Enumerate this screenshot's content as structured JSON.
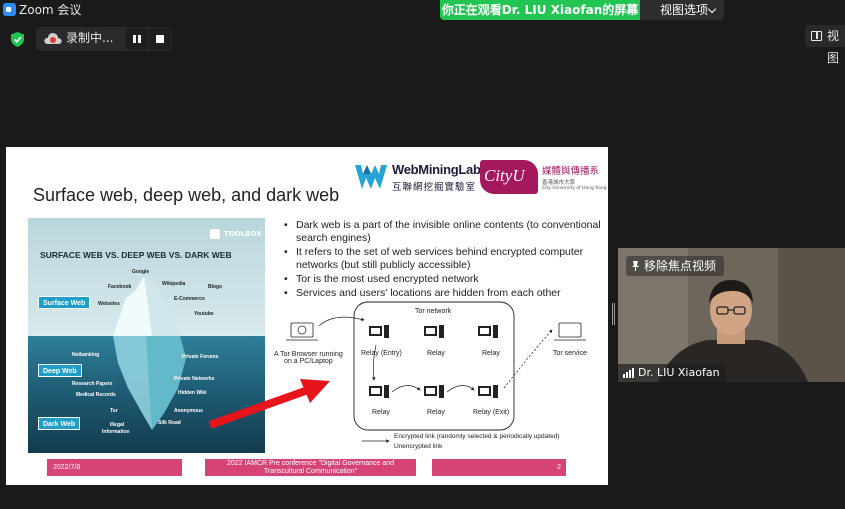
{
  "window": {
    "title": "Zoom 会议"
  },
  "share": {
    "banner": "你正在观看Dr. LIU Xiaofan的屏幕",
    "view_options": "视图选项"
  },
  "toolbar": {
    "recording_label": "录制中...",
    "view_label": "视图"
  },
  "slide": {
    "title": "Surface web, deep web, and dark web",
    "logo": {
      "lab_name": "WebMiningLab",
      "lab_name_zh": "互聯網挖掘實驗室",
      "cityu": "CityU",
      "dept": "媒體與傳播系",
      "univ_zh": "香港城市大學",
      "univ_en": "City University of Hong Kong"
    },
    "bullets": [
      "Dark web is a part of the invisible online contents (to conventional search engines)",
      "It refers to the set of web services behind encrypted computer networks (but still publicly accessible)",
      "Tor is the most used encrypted network",
      "Services and users' locations are hidden from each other"
    ],
    "footer": {
      "date": "2022/7/8",
      "conf_l1": "2022 IAMCR Pre conference \"Digital Governance and",
      "conf_l2": "Transcultural Communication\"",
      "page": "2"
    }
  },
  "iceberg": {
    "brand": "TOOLBOX",
    "title": "SURFACE WEB VS. DEEP WEB VS. DARK WEB",
    "surface": "Surface Web",
    "deep": "Deep Web",
    "dark": "Dark Web",
    "items": [
      "Google",
      "Facebook",
      "Wikipedia",
      "Blogs",
      "Websites",
      "E-Commerce",
      "Youtube",
      "Netbanking",
      "Private Forums",
      "Private Networks",
      "Research Papers",
      "Hidden Wiki",
      "Medical Records",
      "Anonymous",
      "Tor",
      "Silk Road",
      "Illegal",
      "Information"
    ]
  },
  "tor": {
    "browser_l1": "A Tor Browser running",
    "browser_l2": "on a PC/Laptop",
    "network": "Tor network",
    "relays": [
      "Relay (Entry)",
      "Relay",
      "Relay",
      "Relay",
      "Relay",
      "Relay (Exit)"
    ],
    "service": "Tor service",
    "legend_encrypted": "Encrypted link (randomly selected & periodically updated)",
    "legend_unencrypted": "Unencrypted link"
  },
  "video": {
    "unpin_label": "移除焦点视频",
    "participant_name": "Dr. LIU Xiaofan"
  },
  "colors": {
    "share_banner": "#23c552",
    "footer_bar": "#d64477",
    "cityu": "#a3195b",
    "arrow": "#e8141b"
  }
}
